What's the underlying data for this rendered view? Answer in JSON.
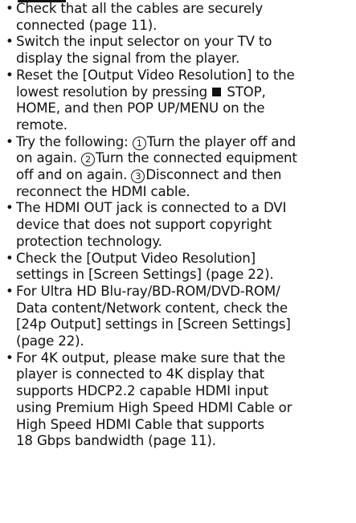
{
  "items": [
    {
      "lines": [
        "Check that all the cables are securely",
        "connected (page 11)."
      ]
    },
    {
      "lines": [
        "Switch the input selector on your TV to",
        "display the signal from the player."
      ]
    },
    {
      "line1_before": "Reset the [Output Video Resolution] to the",
      "line2_before": "lowest resolution by pressing",
      "line2_after": "STOP,",
      "line3": "HOME, and then POP UP/MENU on the",
      "line4": "remote."
    },
    {
      "line1_prefix": "Try the following:",
      "n1": "1",
      "line1_text": "Turn the player off and",
      "line2_before": "on again.",
      "n2": "2",
      "line2_text": "Turn the connected equipment",
      "line3_before": "off and on again.",
      "n3": "3",
      "line3_text": "Disconnect and then",
      "line4": "reconnect the HDMI cable."
    },
    {
      "lines": [
        "The HDMI OUT jack is connected to a DVI",
        "device that does not support copyright",
        "protection technology."
      ]
    },
    {
      "lines": [
        "Check the [Output Video Resolution]",
        "settings in [Screen Settings] (page 22)."
      ]
    },
    {
      "lines": [
        "For Ultra HD Blu-ray/BD-ROM/DVD-ROM/",
        "Data content/Network content, check the",
        "[24p Output] settings in [Screen Settings]",
        "(page 22)."
      ]
    },
    {
      "lines": [
        "For 4K output, please make sure that the",
        "player is connected to 4K display that",
        "supports HDCP2.2 capable HDMI input",
        "using Premium High Speed HDMI Cable or",
        "High Speed HDMI Cable that supports",
        "18 Gbps bandwidth (page 11)."
      ]
    }
  ]
}
